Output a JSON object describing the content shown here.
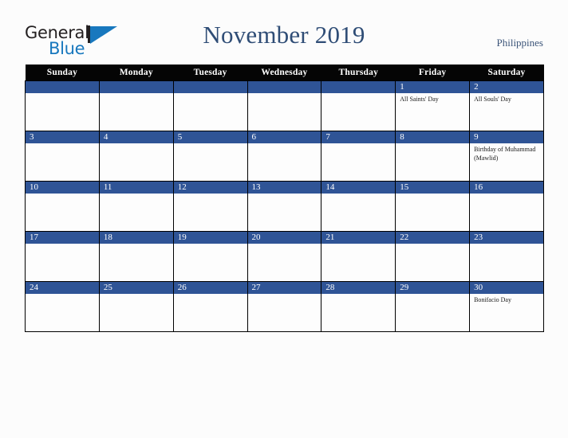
{
  "brand": {
    "name_part1": "General",
    "name_part2": "Blue",
    "logo_icon": "triangle-logo-icon",
    "accent_color": "#1878be",
    "text_color": "#231f20"
  },
  "header": {
    "title": "November 2019",
    "locale": "Philippines",
    "title_color": "#2f4d76"
  },
  "calendar": {
    "month": "November",
    "year": "2019",
    "country": "Philippines",
    "daynum_bar_color": "#2f5496",
    "header_bg_color": "#050505",
    "weekday_headers": [
      "Sunday",
      "Monday",
      "Tuesday",
      "Wednesday",
      "Thursday",
      "Friday",
      "Saturday"
    ],
    "weeks": [
      [
        {
          "day": "",
          "event": ""
        },
        {
          "day": "",
          "event": ""
        },
        {
          "day": "",
          "event": ""
        },
        {
          "day": "",
          "event": ""
        },
        {
          "day": "",
          "event": ""
        },
        {
          "day": "1",
          "event": "All Saints' Day"
        },
        {
          "day": "2",
          "event": "All Souls' Day"
        }
      ],
      [
        {
          "day": "3",
          "event": ""
        },
        {
          "day": "4",
          "event": ""
        },
        {
          "day": "5",
          "event": ""
        },
        {
          "day": "6",
          "event": ""
        },
        {
          "day": "7",
          "event": ""
        },
        {
          "day": "8",
          "event": ""
        },
        {
          "day": "9",
          "event": "Birthday of Muhammad (Mawlid)"
        }
      ],
      [
        {
          "day": "10",
          "event": ""
        },
        {
          "day": "11",
          "event": ""
        },
        {
          "day": "12",
          "event": ""
        },
        {
          "day": "13",
          "event": ""
        },
        {
          "day": "14",
          "event": ""
        },
        {
          "day": "15",
          "event": ""
        },
        {
          "day": "16",
          "event": ""
        }
      ],
      [
        {
          "day": "17",
          "event": ""
        },
        {
          "day": "18",
          "event": ""
        },
        {
          "day": "19",
          "event": ""
        },
        {
          "day": "20",
          "event": ""
        },
        {
          "day": "21",
          "event": ""
        },
        {
          "day": "22",
          "event": ""
        },
        {
          "day": "23",
          "event": ""
        }
      ],
      [
        {
          "day": "24",
          "event": ""
        },
        {
          "day": "25",
          "event": ""
        },
        {
          "day": "26",
          "event": ""
        },
        {
          "day": "27",
          "event": ""
        },
        {
          "day": "28",
          "event": ""
        },
        {
          "day": "29",
          "event": ""
        },
        {
          "day": "30",
          "event": "Bonifacio Day"
        }
      ]
    ]
  }
}
